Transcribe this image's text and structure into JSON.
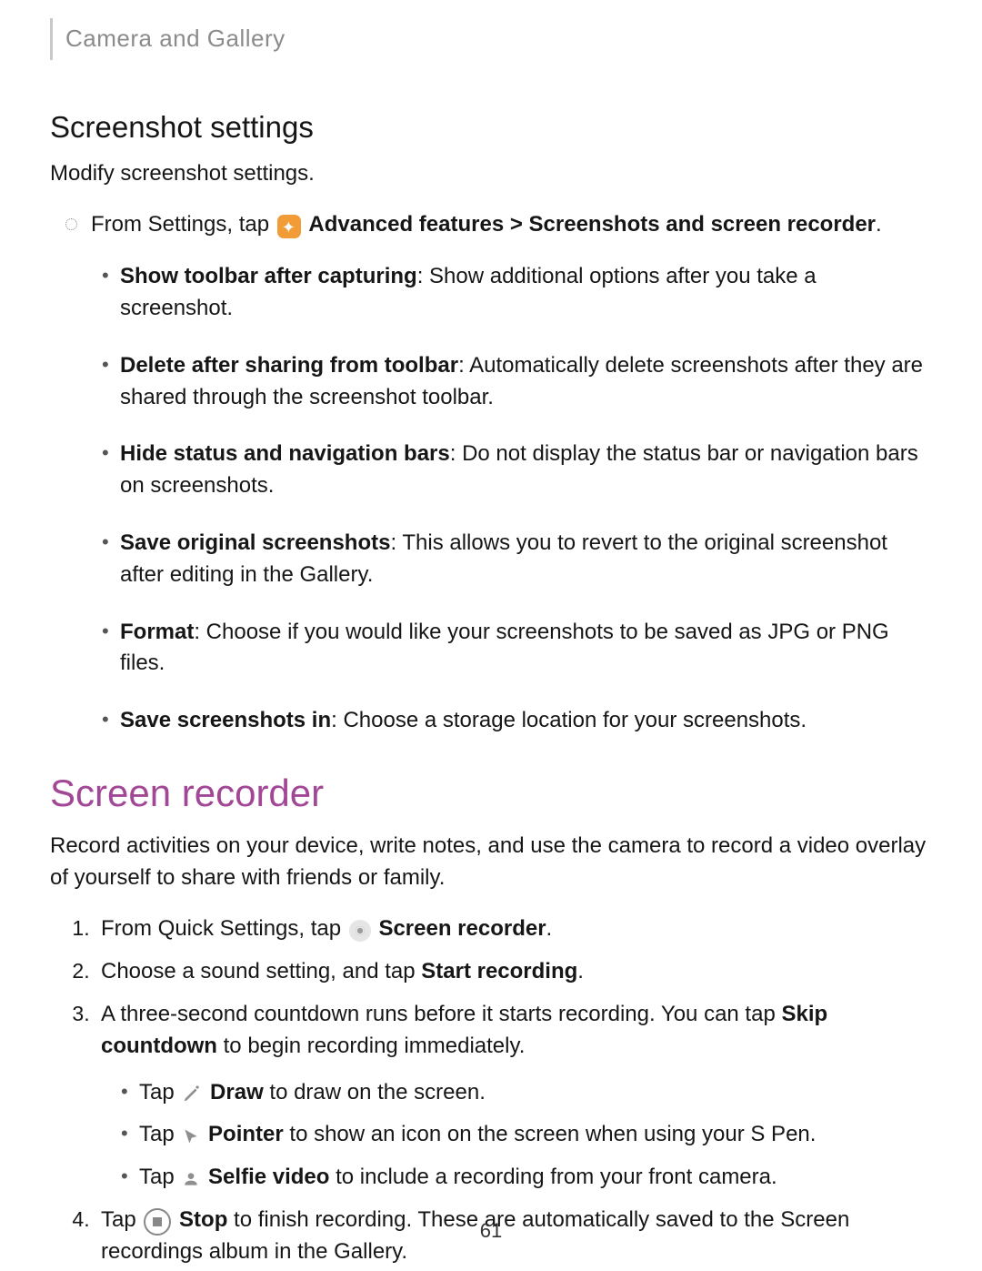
{
  "breadcrumb": "Camera and Gallery",
  "section1": {
    "title": "Screenshot settings",
    "lead": "Modify screenshot settings.",
    "step_prefix": "From Settings, tap",
    "step_bold": "Advanced features > Screenshots and screen recorder",
    "step_suffix": ".",
    "options": [
      {
        "label": "Show toolbar after capturing",
        "desc": ": Show additional options after you take a screenshot."
      },
      {
        "label": "Delete after sharing from toolbar",
        "desc": ": Automatically delete screenshots after they are shared through the screenshot toolbar."
      },
      {
        "label": "Hide status and navigation bars",
        "desc": ": Do not display the status bar or navigation bars on screenshots."
      },
      {
        "label": "Save original screenshots",
        "desc": ": This allows you to revert to the original screenshot after editing in the Gallery."
      },
      {
        "label": "Format",
        "desc": ": Choose if you would like your screenshots to be saved as JPG or PNG files."
      },
      {
        "label": "Save screenshots in",
        "desc": ": Choose a storage location for your screenshots."
      }
    ]
  },
  "section2": {
    "title": "Screen recorder",
    "lead": "Record activities on your device, write notes, and use the camera to record a video overlay of yourself to share with friends or family.",
    "steps": {
      "s1_prefix": "From Quick Settings, tap",
      "s1_bold": "Screen recorder",
      "s1_suffix": ".",
      "s2_prefix": "Choose a sound setting, and tap ",
      "s2_bold": "Start recording",
      "s2_suffix": ".",
      "s3_prefix": "A three-second countdown runs before it starts recording. You can tap ",
      "s3_bold": "Skip countdown",
      "s3_suffix": " to begin recording immediately.",
      "s3_sub": [
        {
          "pre": "Tap ",
          "label": "Draw",
          "post": " to draw on the screen."
        },
        {
          "pre": "Tap ",
          "label": "Pointer",
          "post": " to show an icon on the screen when using your S Pen."
        },
        {
          "pre": "Tap ",
          "label": "Selfie video",
          "post": " to include a recording from your front camera."
        }
      ],
      "s4_prefix": "Tap ",
      "s4_bold": "Stop",
      "s4_suffix": " to finish recording. These are automatically saved to the Screen recordings album in the Gallery."
    }
  },
  "page_number": "61"
}
